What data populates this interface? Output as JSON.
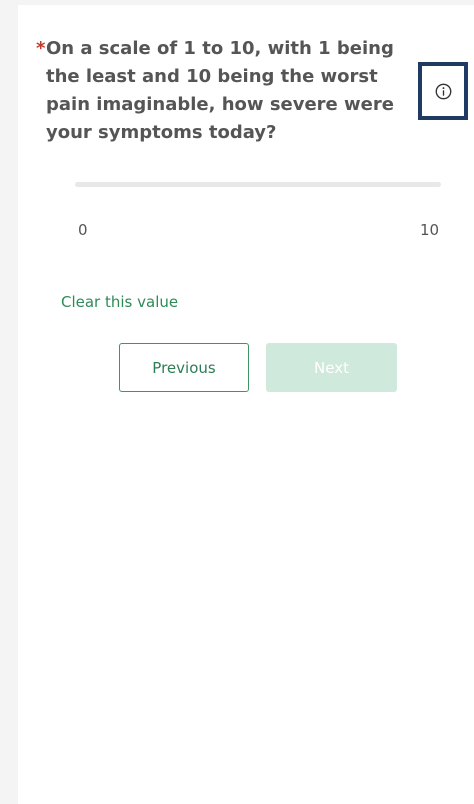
{
  "question": {
    "required_marker": "*",
    "text": "On a scale of 1 to 10, with 1 being the least and 10 being the worst pain imaginable, how severe were your symptoms today?"
  },
  "info_icon": "info-circle-icon",
  "slider": {
    "min_label": "0",
    "max_label": "10",
    "value": null
  },
  "clear_link": "Clear this value",
  "buttons": {
    "previous": "Previous",
    "next": "Next"
  },
  "colors": {
    "accent": "#2e8b57",
    "required": "#c0392b",
    "focus_outline": "#1f3b63",
    "next_disabled": "#cfe9dd"
  }
}
